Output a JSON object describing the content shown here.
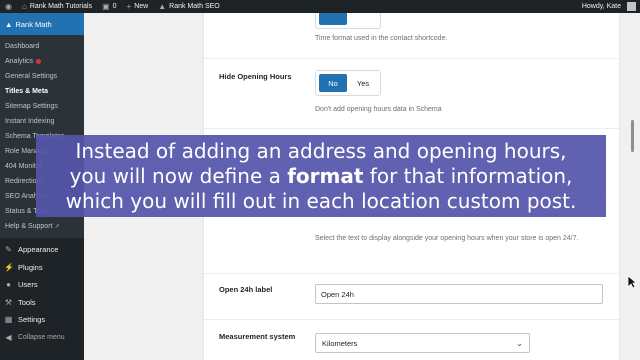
{
  "adminbar": {
    "site_name": "Rank Math Tutorials",
    "comments_count": "0",
    "new_label": "New",
    "plugin_label": "Rank Math SEO",
    "greeting": "Howdy, Kate"
  },
  "sidebar": {
    "header": "Rank Math",
    "submenu": [
      {
        "label": "Dashboard"
      },
      {
        "label": "Analytics"
      },
      {
        "label": "General Settings"
      },
      {
        "label": "Titles & Meta"
      },
      {
        "label": "Sitemap Settings"
      },
      {
        "label": "Instant Indexing"
      },
      {
        "label": "Schema Templates"
      },
      {
        "label": "Role Manager"
      },
      {
        "label": "404 Monitor"
      },
      {
        "label": "Redirections"
      },
      {
        "label": "SEO Analysis"
      },
      {
        "label": "Status & Tools"
      },
      {
        "label": "Help & Support"
      }
    ],
    "menu": [
      {
        "label": "Appearance",
        "icon": "paintbrush-icon"
      },
      {
        "label": "Plugins",
        "icon": "plugin-icon"
      },
      {
        "label": "Users",
        "icon": "users-icon"
      },
      {
        "label": "Tools",
        "icon": "tools-icon"
      },
      {
        "label": "Settings",
        "icon": "settings-icon"
      },
      {
        "label": "Collapse menu",
        "icon": "collapse-icon"
      }
    ]
  },
  "settings": {
    "time_format_desc": "Time format used in the contact shortcode.",
    "hide_hours": {
      "label": "Hide Opening Hours",
      "options": [
        "No",
        "Yes"
      ],
      "selected": "No",
      "desc": "Don't add opening hours data in Schema"
    },
    "opening_hours_desc": "Select the text to display alongside your opening hours when your store is open 24/7.",
    "open24": {
      "label": "Open 24h label",
      "value": "Open 24h"
    },
    "measurement": {
      "label": "Measurement system",
      "value": "Kilometers"
    }
  },
  "caption": {
    "line1": "Instead of adding an address and opening hours,",
    "line2_pre": "you will now define a ",
    "line2_bold": "format",
    "line2_post": " for that information,",
    "line3": "which you will fill out in each location custom post."
  },
  "colors": {
    "admin_dark": "#1d2327",
    "accent_blue": "#2271b1",
    "caption_bg": "#5455aa"
  }
}
